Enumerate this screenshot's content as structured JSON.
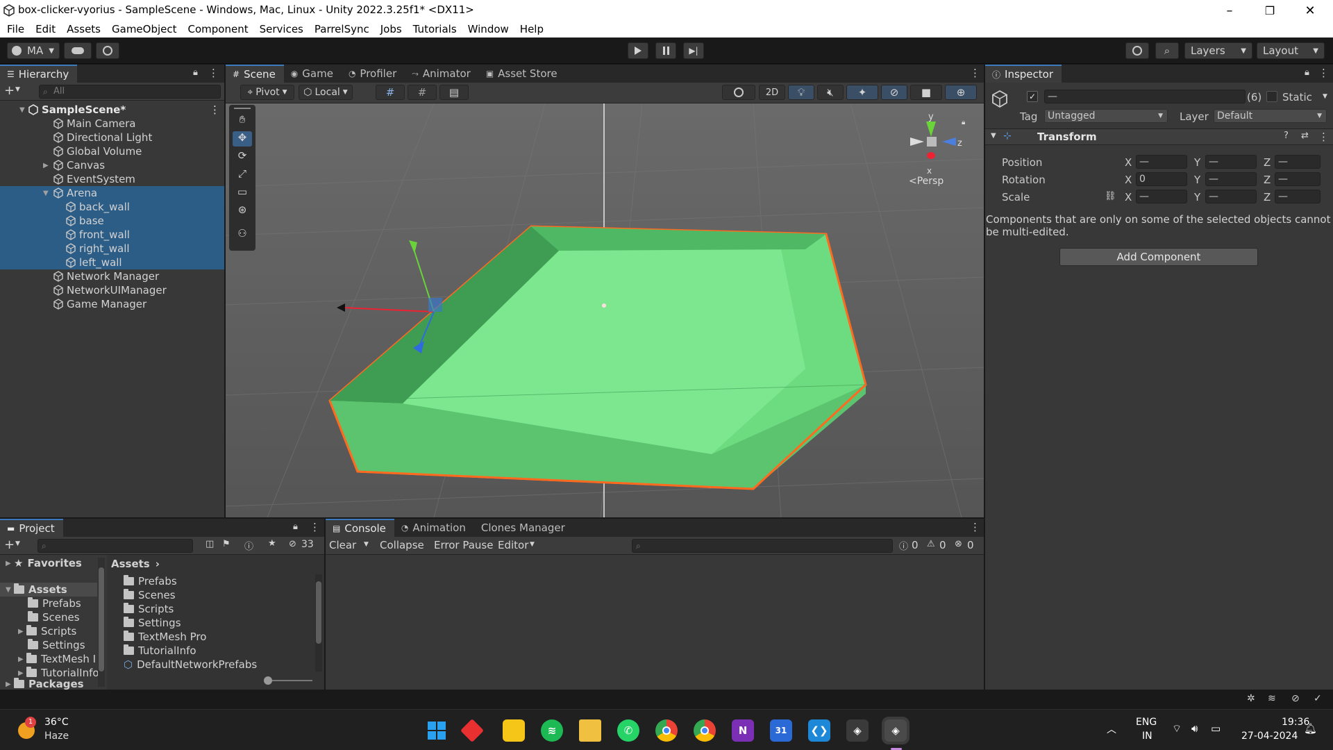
{
  "window": {
    "title": "box-clicker-vyorius - SampleScene - Windows, Mac, Linux - Unity 2022.3.25f1* <DX11>",
    "controls": [
      "–",
      "❐",
      "✕"
    ]
  },
  "menu": [
    "File",
    "Edit",
    "Assets",
    "GameObject",
    "Component",
    "Services",
    "ParrelSync",
    "Jobs",
    "Tutorials",
    "Window",
    "Help"
  ],
  "toolbar": {
    "account_label": "MA",
    "layers_label": "Layers",
    "layout_label": "Layout"
  },
  "hierarchy": {
    "tab": "Hierarchy",
    "search_placeholder": "All",
    "scene": "SampleScene*",
    "items": [
      {
        "label": "Main Camera"
      },
      {
        "label": "Directional Light"
      },
      {
        "label": "Global Volume"
      },
      {
        "label": "Canvas"
      },
      {
        "label": "EventSystem"
      },
      {
        "label": "Arena"
      },
      {
        "label": "back_wall"
      },
      {
        "label": "base"
      },
      {
        "label": "front_wall"
      },
      {
        "label": "right_wall"
      },
      {
        "label": "left_wall"
      },
      {
        "label": "Network Manager"
      },
      {
        "label": "NetworkUIManager"
      },
      {
        "label": "Game Manager"
      }
    ]
  },
  "scene_tabs": [
    "Scene",
    "Game",
    "Profiler",
    "Animator",
    "Asset Store"
  ],
  "scene_toolbar": {
    "pivot": "Pivot",
    "local": "Local",
    "mode_2d": "2D"
  },
  "gizmo": {
    "y": "y",
    "z": "z",
    "x": "x",
    "persp": "<Persp"
  },
  "inspector": {
    "tab": "Inspector",
    "name_value": "—",
    "count": "(6)",
    "static_label": "Static",
    "tag_label": "Tag",
    "tag_value": "Untagged",
    "layer_label": "Layer",
    "layer_value": "Default",
    "transform_title": "Transform",
    "position_label": "Position",
    "rotation_label": "Rotation",
    "scale_label": "Scale",
    "axis_x": "X",
    "axis_y": "Y",
    "axis_z": "Z",
    "dash": "—",
    "rotation_x": "0",
    "note": "Components that are only on some of the selected objects cannot be multi-edited.",
    "add_component": "Add Component"
  },
  "project": {
    "tab": "Project",
    "hidden_count": "33",
    "favorites": "Favorites",
    "assets": "Assets",
    "tree": [
      "Prefabs",
      "Scenes",
      "Scripts",
      "Settings",
      "TextMesh I",
      "TutorialInfo"
    ],
    "packages": "Packages",
    "breadcrumb": "Assets",
    "files": [
      "Prefabs",
      "Scenes",
      "Scripts",
      "Settings",
      "TextMesh Pro",
      "TutorialInfo",
      "DefaultNetworkPrefabs"
    ]
  },
  "console": {
    "tabs": [
      "Console",
      "Animation",
      "Clones Manager"
    ],
    "clear": "Clear",
    "collapse": "Collapse",
    "error_pause": "Error Pause",
    "editor": "Editor",
    "log_count": "0",
    "warn_count": "0",
    "error_count": "0"
  },
  "taskbar": {
    "weather_temp": "36°C",
    "weather_desc": "Haze",
    "weather_badge": "1",
    "lang1": "ENG",
    "lang2": "IN",
    "time": "19:36",
    "date": "27-04-2024",
    "app_icons": [
      "windows-start",
      "git-app",
      "sticky-notes",
      "spotify",
      "file-explorer",
      "whatsapp",
      "chrome-profile",
      "chrome",
      "onenote",
      "calendar",
      "vscode",
      "unity-hub",
      "unity-editor"
    ]
  }
}
